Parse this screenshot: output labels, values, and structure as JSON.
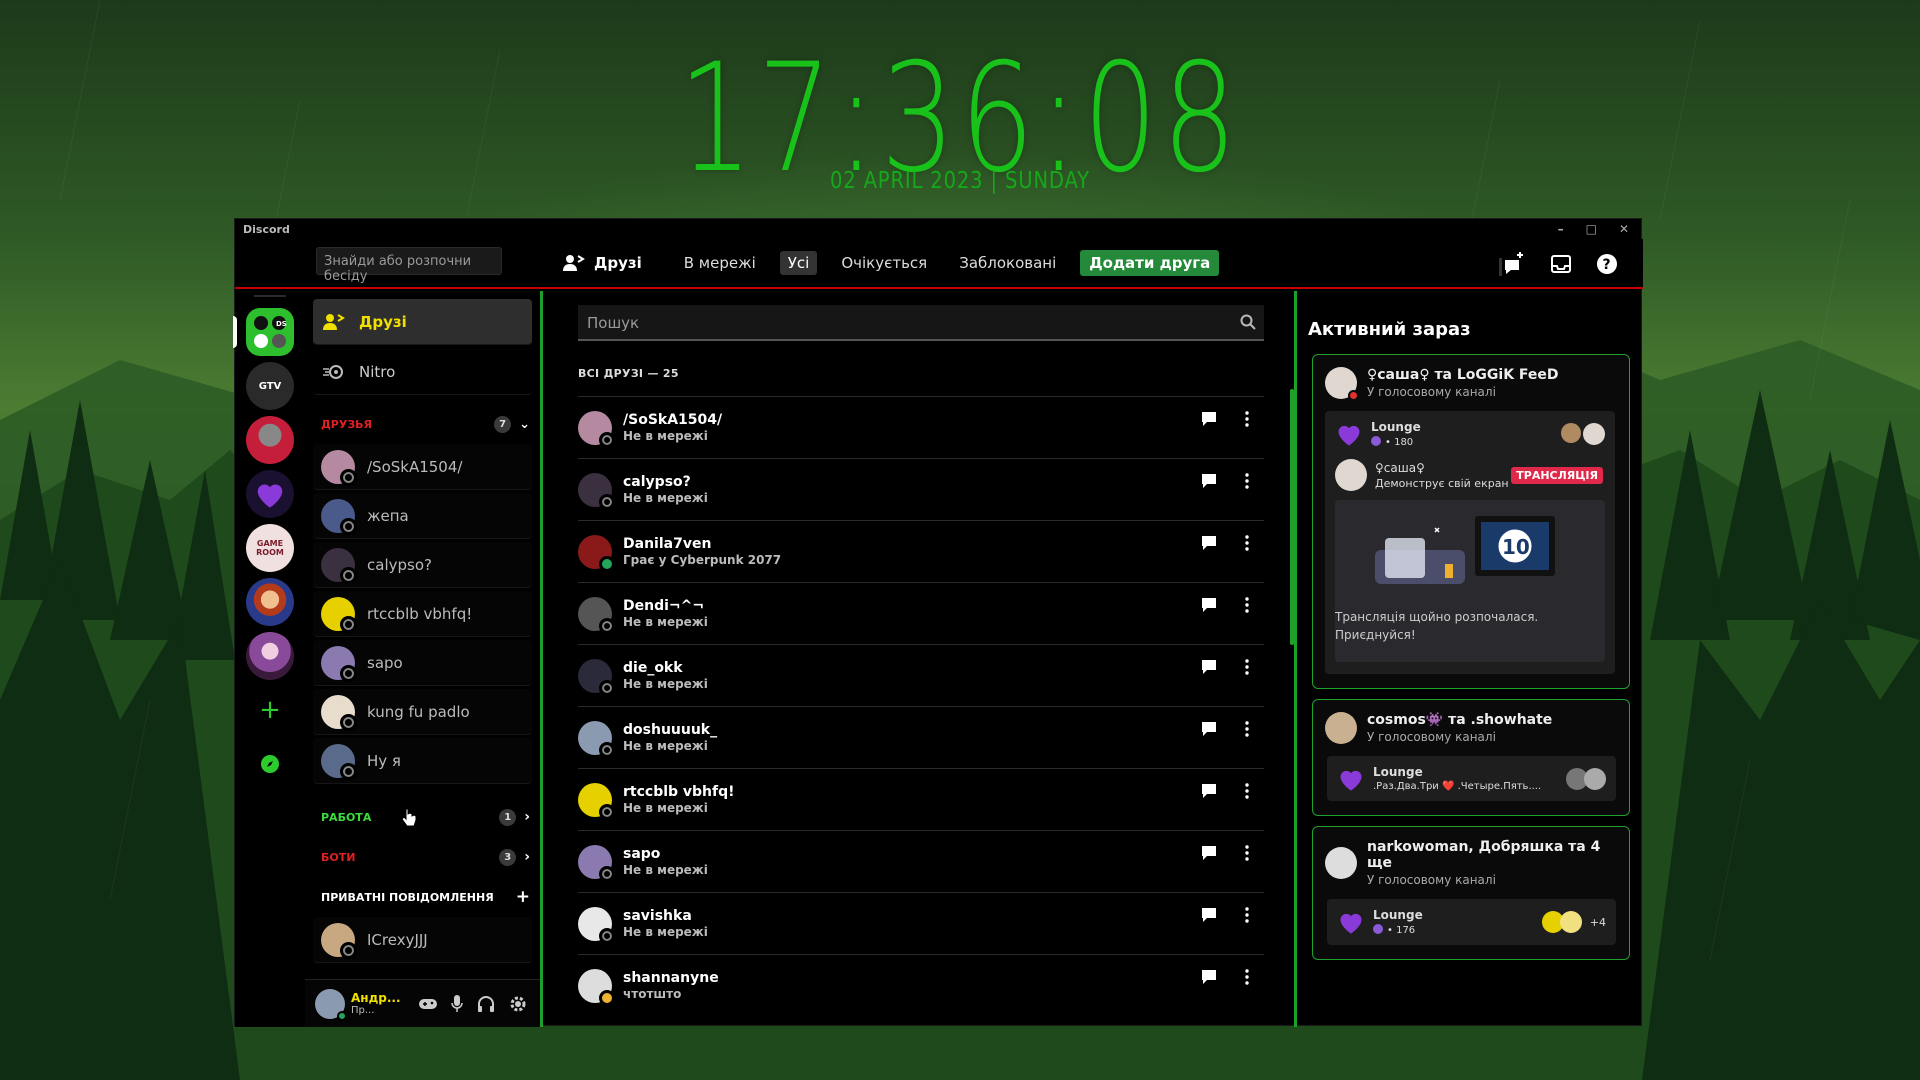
{
  "clock": {
    "time": "17:36:08",
    "date": "02 APRIL 2023 | SUNDAY"
  },
  "window": {
    "title": "Discord",
    "controls": [
      "–",
      "□",
      "✕"
    ]
  },
  "search_dm": {
    "placeholder": "Знайди або розпочни бесіду"
  },
  "topnav": {
    "friends_label": "Друзі",
    "tabs": [
      "В мережі",
      "Усі",
      "Очікується",
      "Заблоковані"
    ],
    "selected_tab": "Усі",
    "add_friend": "Додати друга"
  },
  "guilds": [
    {
      "name": "DS group",
      "color": "#2dbf2d"
    },
    {
      "name": "GTV",
      "color": "#3a3a3a",
      "label": "GTV"
    },
    {
      "name": "Anime",
      "color": "#c41e3a"
    },
    {
      "name": "Heart",
      "color": "#6a2aa8"
    },
    {
      "name": "GAME ROOM",
      "color": "#7a1a2a",
      "label": "GAME ROOM"
    },
    {
      "name": "Cartoon",
      "color": "#b33a1a"
    },
    {
      "name": "Girl",
      "color": "#8a4a9a"
    }
  ],
  "channels": {
    "friends": "Друзі",
    "nitro": "Nitro",
    "sections": {
      "friends": {
        "label": "ДРУЗЬЯ",
        "count": "7",
        "color": "#e02020"
      },
      "work": {
        "label": "РАБОТА",
        "count": "1",
        "color": "#3ddc3d"
      },
      "bots": {
        "label": "БОТИ",
        "count": "3",
        "color": "#e02020"
      },
      "dm": {
        "label": "ПРИВАТНІ ПОВІДОМЛЕННЯ",
        "color": "#ffffff"
      }
    },
    "friend_items": [
      "/SoSkA1504/",
      "жепа",
      "calypso?",
      "rtccblb vbhfq!",
      "sapo",
      "kung fu padlo",
      "Ну я"
    ],
    "dm_items": [
      "ICrexyJJJ"
    ]
  },
  "user": {
    "name": "Андр...",
    "status": "Пр..."
  },
  "main": {
    "search_placeholder": "Пошук",
    "header": "ВСІ ДРУЗІ — 25",
    "friends": [
      {
        "name": "/SoSkA1504/",
        "status": "Не в мережі",
        "state": "off",
        "color": "#b58aa0"
      },
      {
        "name": "calypso?",
        "status": "Не в мережі",
        "state": "off",
        "color": "#3a3040"
      },
      {
        "name": "Danila7ven",
        "status": "Грає у Cyberpunk 2077",
        "state": "on",
        "color": "#8a1a1a"
      },
      {
        "name": "Dendi¬^¬",
        "status": "Не в мережі",
        "state": "off",
        "color": "#555"
      },
      {
        "name": "die_okk",
        "status": "Не в мережі",
        "state": "off",
        "color": "#2a2a3a"
      },
      {
        "name": "doshuuuuk_",
        "status": "Не в мережі",
        "state": "off",
        "color": "#8a9ab0"
      },
      {
        "name": "rtccblb vbhfq!",
        "status": "Не в мережі",
        "state": "off",
        "color": "#e6d000"
      },
      {
        "name": "sapo",
        "status": "Не в мережі",
        "state": "off",
        "color": "#8a7ab0"
      },
      {
        "name": "savishka",
        "status": "Не в мережі",
        "state": "off",
        "color": "#e8e8e8"
      },
      {
        "name": "shannanyne",
        "status": "чтотшто",
        "state": "idle",
        "color": "#ddd"
      }
    ]
  },
  "active": {
    "title": "Активний зараз",
    "cards": [
      {
        "title": "♀саша♀ та LoGGiK FeeD",
        "sub": "У голосовому каналі",
        "channel": "Lounge",
        "channel_sub": "• 180",
        "streamer": "♀саша♀",
        "streamer_sub": "Демонструє свій екран",
        "live": "ТРАНСЛЯЦІЯ",
        "preview_text_1": "Трансляція щойно розпочалася.",
        "preview_text_2": "Приєднуйся!",
        "preview_badge": "10"
      },
      {
        "title": "cosmos👾 та .showhate",
        "sub": "У голосовому каналі",
        "channel": "Lounge",
        "channel_sub": ".Раз.Два.Три ❤️ .Четыре.Пять...."
      },
      {
        "title": "narkowoman, Добряшка та 4 ще",
        "sub": "У голосовому каналі",
        "channel": "Lounge",
        "channel_sub": "• 176",
        "more": "+4"
      }
    ]
  }
}
